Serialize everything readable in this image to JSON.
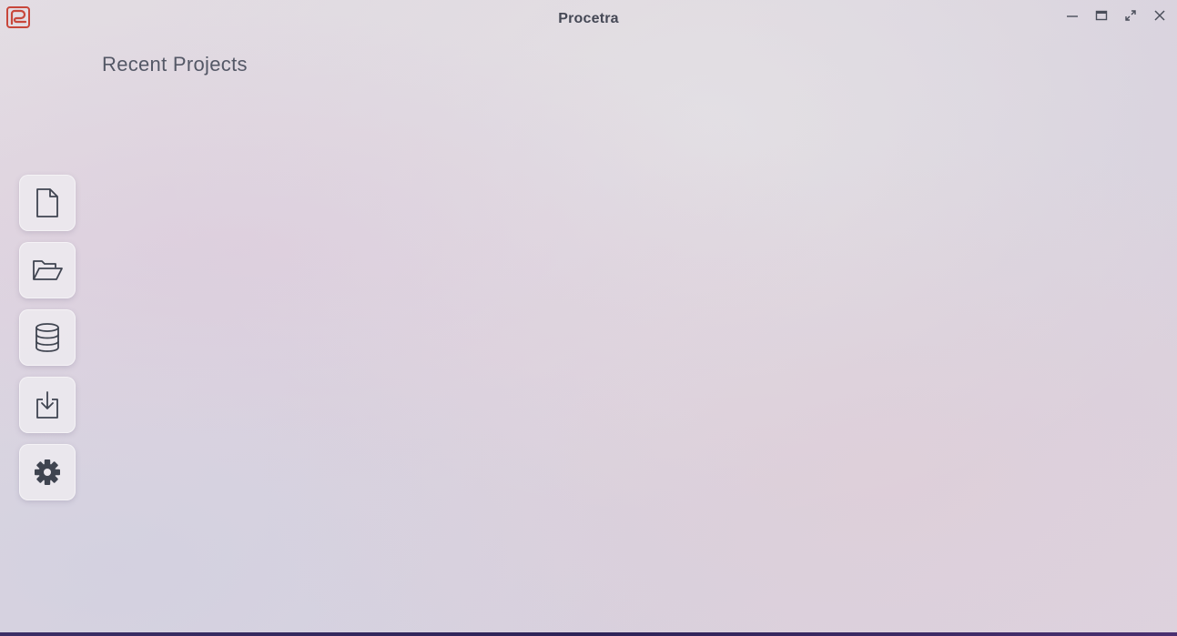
{
  "window": {
    "title": "Procetra",
    "controls": [
      "minimize-icon",
      "restore-icon",
      "maximize-icon",
      "close-icon"
    ]
  },
  "main": {
    "heading": "Recent Projects"
  },
  "sidebar": {
    "items": [
      {
        "icon": "new-file-icon"
      },
      {
        "icon": "open-folder-icon"
      },
      {
        "icon": "database-icon"
      },
      {
        "icon": "import-icon"
      },
      {
        "icon": "gear-icon"
      }
    ]
  },
  "colors": {
    "logo": "#c8473b",
    "icon": "#3f4450",
    "title": "#454855",
    "heading": "#545866",
    "button_bg": "#ece8ee"
  }
}
